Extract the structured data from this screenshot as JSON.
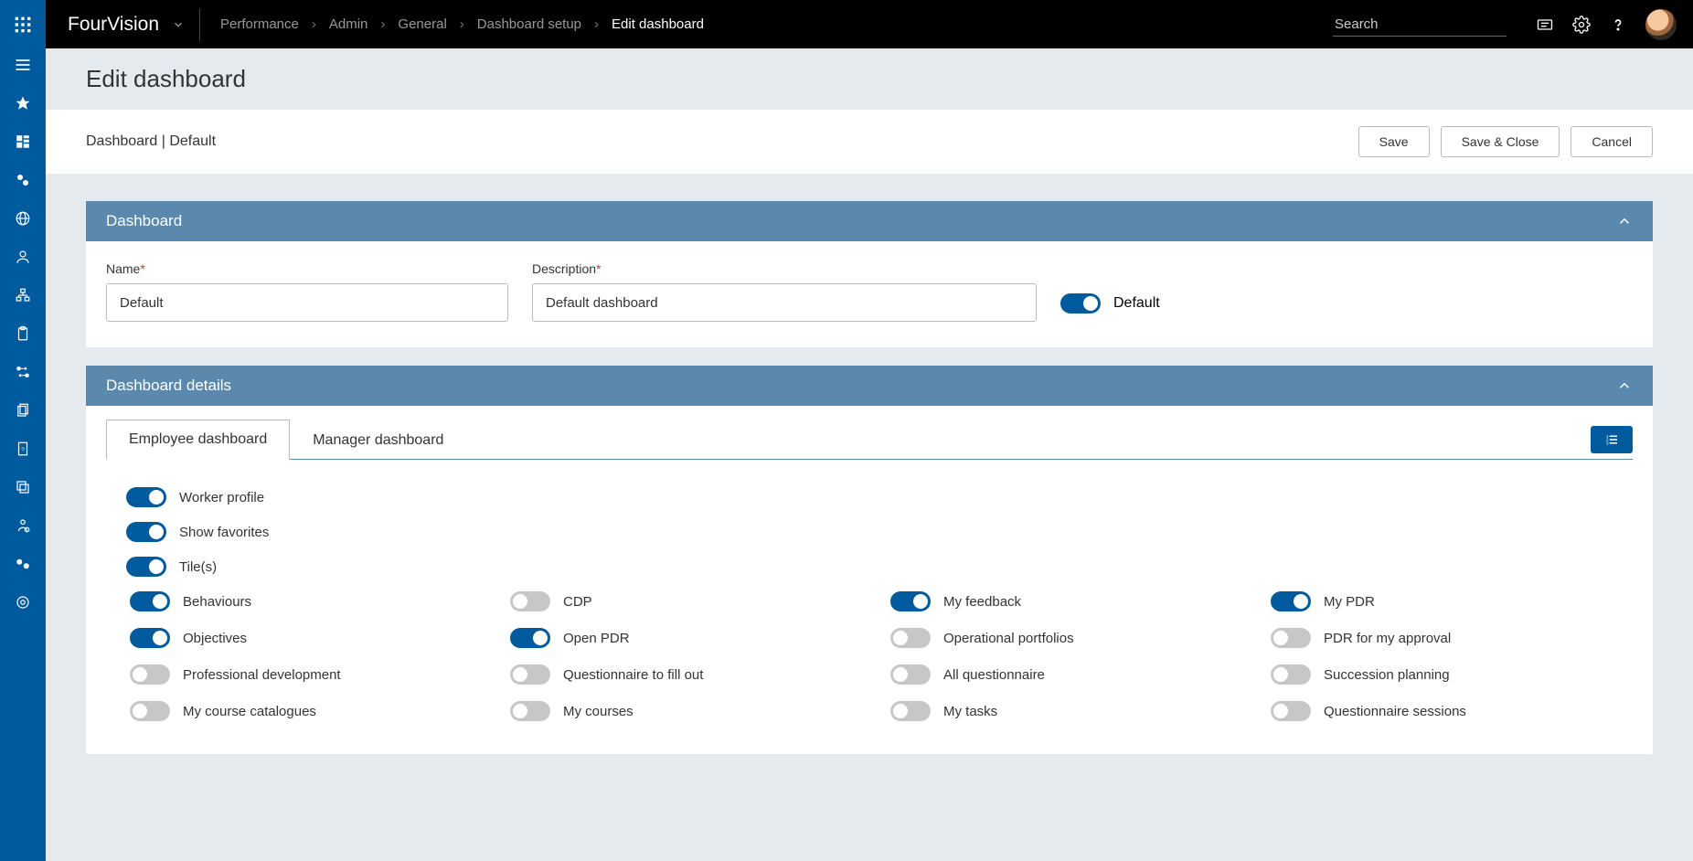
{
  "header": {
    "brand": "FourVision",
    "search_placeholder": "Search",
    "breadcrumb": [
      "Performance",
      "Admin",
      "General",
      "Dashboard setup",
      "Edit dashboard"
    ]
  },
  "page": {
    "title": "Edit dashboard",
    "subtitle": "Dashboard | Default",
    "buttons": {
      "save": "Save",
      "save_close": "Save & Close",
      "cancel": "Cancel"
    }
  },
  "panel_dashboard": {
    "title": "Dashboard",
    "name_label": "Name",
    "name_value": "Default",
    "desc_label": "Description",
    "desc_value": "Default dashboard",
    "default_label": "Default",
    "default_on": true
  },
  "panel_details": {
    "title": "Dashboard details",
    "tabs": [
      "Employee dashboard",
      "Manager dashboard"
    ],
    "active_tab": 0,
    "top_toggles": [
      {
        "label": "Worker profile",
        "on": true
      },
      {
        "label": "Show favorites",
        "on": true
      },
      {
        "label": "Tile(s)",
        "on": true
      }
    ],
    "tiles": [
      {
        "label": "Behaviours",
        "on": true
      },
      {
        "label": "CDP",
        "on": false
      },
      {
        "label": "My feedback",
        "on": true
      },
      {
        "label": "My PDR",
        "on": true
      },
      {
        "label": "Objectives",
        "on": true
      },
      {
        "label": "Open PDR",
        "on": true
      },
      {
        "label": "Operational portfolios",
        "on": false
      },
      {
        "label": "PDR for my approval",
        "on": false
      },
      {
        "label": "Professional development",
        "on": false
      },
      {
        "label": "Questionnaire to fill out",
        "on": false
      },
      {
        "label": "All questionnaire",
        "on": false
      },
      {
        "label": "Succession planning",
        "on": false
      },
      {
        "label": "My course catalogues",
        "on": false
      },
      {
        "label": "My courses",
        "on": false
      },
      {
        "label": "My tasks",
        "on": false
      },
      {
        "label": "Questionnaire sessions",
        "on": false
      }
    ]
  }
}
